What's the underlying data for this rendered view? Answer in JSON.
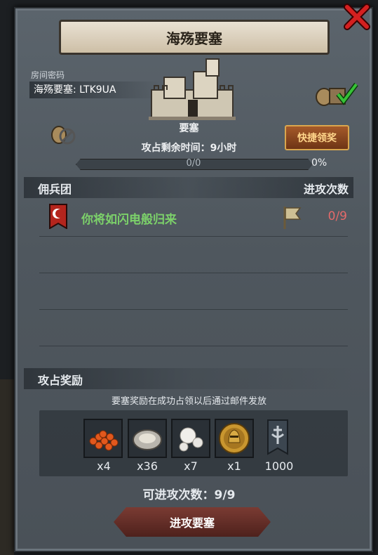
{
  "title": "海殇要塞",
  "room": {
    "label": "房间密码",
    "value": "海殇要塞: LTK9UA"
  },
  "fortress": {
    "name": "要塞",
    "time_left": "攻占剩余时间：9小时"
  },
  "progress": {
    "text": "0/0",
    "percent_label": "0%",
    "fraction": 0
  },
  "quick_claim_label": "快捷领奖",
  "mercenary": {
    "header_left": "佣兵团",
    "header_right": "进攻次数",
    "rows": [
      {
        "name": "你将如闪电般归来",
        "count": "0/9"
      }
    ]
  },
  "rewards": {
    "title": "攻占奖励",
    "note": "要塞奖励在成功占领以后通过邮件发放",
    "items": [
      {
        "icon": "roe-icon",
        "qty": "x4"
      },
      {
        "icon": "oyster-icon",
        "qty": "x36"
      },
      {
        "icon": "pearl-icon",
        "qty": "x7"
      },
      {
        "icon": "knight-coin-icon",
        "qty": "x1"
      },
      {
        "icon": "banner-icon",
        "qty": "1000"
      }
    ]
  },
  "attempts": "可进攻次数：9/9",
  "attack_button": "进攻要塞",
  "colors": {
    "accent_green": "#7cd16a",
    "count_red": "#e46a6a",
    "quick_btn_text": "#ffd58a"
  }
}
